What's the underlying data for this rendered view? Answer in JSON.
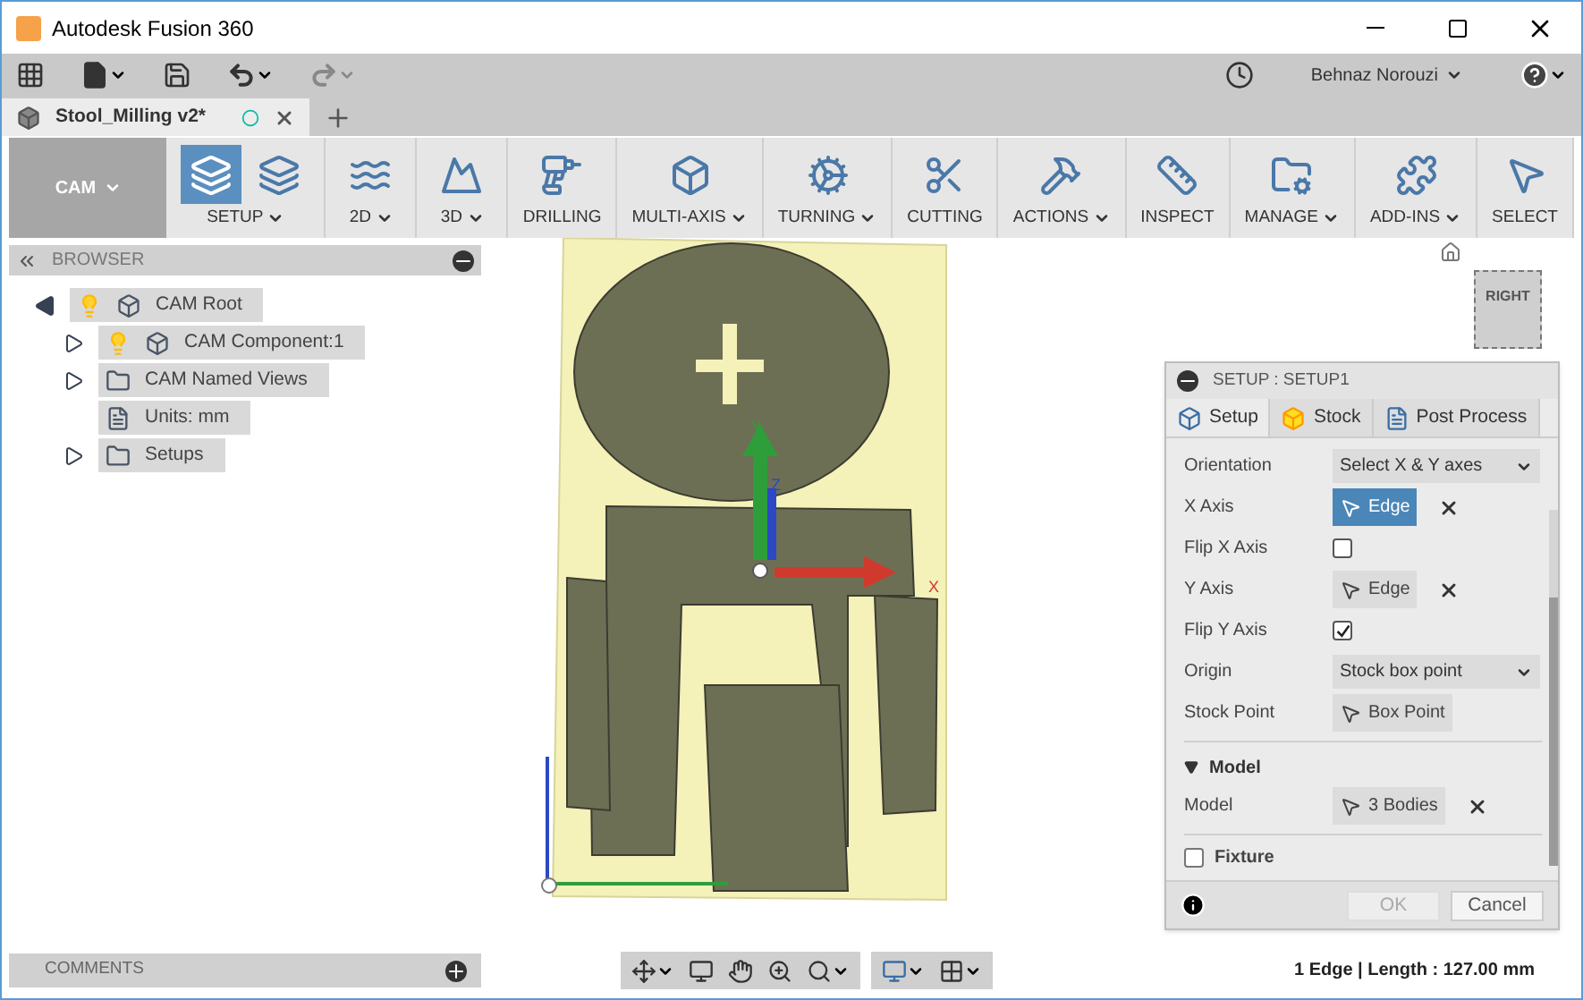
{
  "window": {
    "title": "Autodesk Fusion 360"
  },
  "toolbar": {
    "user": "Behnaz Norouzi"
  },
  "document_tab": {
    "title": "Stool_Milling v2*"
  },
  "ribbon": {
    "workspace": "CAM",
    "groups": [
      {
        "label": "SETUP",
        "dropdown": true,
        "selected": true
      },
      {
        "label": "2D",
        "dropdown": true,
        "selected": false
      },
      {
        "label": "3D",
        "dropdown": true,
        "selected": false
      },
      {
        "label": "DRILLING",
        "dropdown": false,
        "selected": false
      },
      {
        "label": "MULTI-AXIS",
        "dropdown": true,
        "selected": false
      },
      {
        "label": "TURNING",
        "dropdown": true,
        "selected": false
      },
      {
        "label": "CUTTING",
        "dropdown": false,
        "selected": false
      },
      {
        "label": "ACTIONS",
        "dropdown": true,
        "selected": false
      },
      {
        "label": "INSPECT",
        "dropdown": false,
        "selected": false
      },
      {
        "label": "MANAGE",
        "dropdown": true,
        "selected": false
      },
      {
        "label": "ADD-INS",
        "dropdown": true,
        "selected": false
      },
      {
        "label": "SELECT",
        "dropdown": false,
        "selected": false
      }
    ]
  },
  "browser": {
    "title": "BROWSER",
    "tree": [
      {
        "label": "CAM Root",
        "kind": "root",
        "expanded": true,
        "children": [
          {
            "label": "CAM Component:1",
            "kind": "component",
            "expanded": false
          },
          {
            "label": "CAM Named Views",
            "kind": "folder",
            "expanded": false
          },
          {
            "label": "Units: mm",
            "kind": "units"
          },
          {
            "label": "Setups",
            "kind": "setups",
            "expanded": false
          }
        ]
      }
    ]
  },
  "viewport": {
    "axes": [
      "X",
      "Y",
      "Z"
    ],
    "view_cube": "RIGHT"
  },
  "dialog": {
    "title": "SETUP : SETUP1",
    "tabs": [
      {
        "label": "Setup",
        "selected": true
      },
      {
        "label": "Stock",
        "selected": false
      },
      {
        "label": "Post Process",
        "selected": false
      }
    ],
    "rows": [
      {
        "kind": "select",
        "label": "Orientation",
        "value": "Select X & Y axes"
      },
      {
        "kind": "pick",
        "label": "X Axis",
        "value": "Edge",
        "active": true,
        "clear": true
      },
      {
        "kind": "checkbox",
        "label": "Flip X Axis",
        "checked": false
      },
      {
        "kind": "pick",
        "label": "Y Axis",
        "value": "Edge",
        "active": false,
        "clear": true
      },
      {
        "kind": "checkbox",
        "label": "Flip Y Axis",
        "checked": true
      },
      {
        "kind": "select",
        "label": "Origin",
        "value": "Stock box point"
      },
      {
        "kind": "pick",
        "label": "Stock Point",
        "value": "Box Point",
        "active": false,
        "clear": false
      }
    ],
    "model_section": {
      "title": "Model",
      "expanded": true,
      "rows": [
        {
          "kind": "pick",
          "label": "Model",
          "value": "3 Bodies",
          "active": false,
          "clear": true
        }
      ]
    },
    "fixture": {
      "label": "Fixture",
      "checked": false
    },
    "buttons": [
      "OK",
      "Cancel"
    ]
  },
  "comments": {
    "title": "COMMENTS"
  },
  "status": "1 Edge | Length : 127.00 mm"
}
